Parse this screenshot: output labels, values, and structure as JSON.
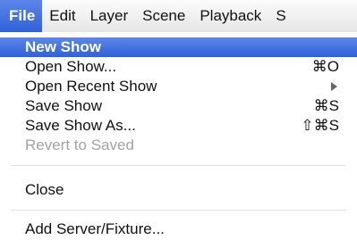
{
  "menubar": {
    "items": [
      {
        "label": "File"
      },
      {
        "label": "Edit"
      },
      {
        "label": "Layer"
      },
      {
        "label": "Scene"
      },
      {
        "label": "Playback"
      },
      {
        "label": "S"
      }
    ]
  },
  "file_menu": {
    "new_show": {
      "label": "New Show"
    },
    "open_show": {
      "label": "Open Show...",
      "shortcut": "⌘O"
    },
    "open_recent_show": {
      "label": "Open Recent Show",
      "submenu_icon": "triangle-right-icon"
    },
    "save_show": {
      "label": "Save Show",
      "shortcut": "⌘S"
    },
    "save_show_as": {
      "label": "Save Show As...",
      "shortcut": "⇧⌘S"
    },
    "revert_to_saved": {
      "label": "Revert to Saved",
      "disabled": true
    },
    "close": {
      "label": "Close"
    },
    "add_server_fixture": {
      "label": "Add Server/Fixture..."
    }
  },
  "colors": {
    "highlight": "#3a6bdc",
    "disabled_text": "#a3a3a3"
  }
}
